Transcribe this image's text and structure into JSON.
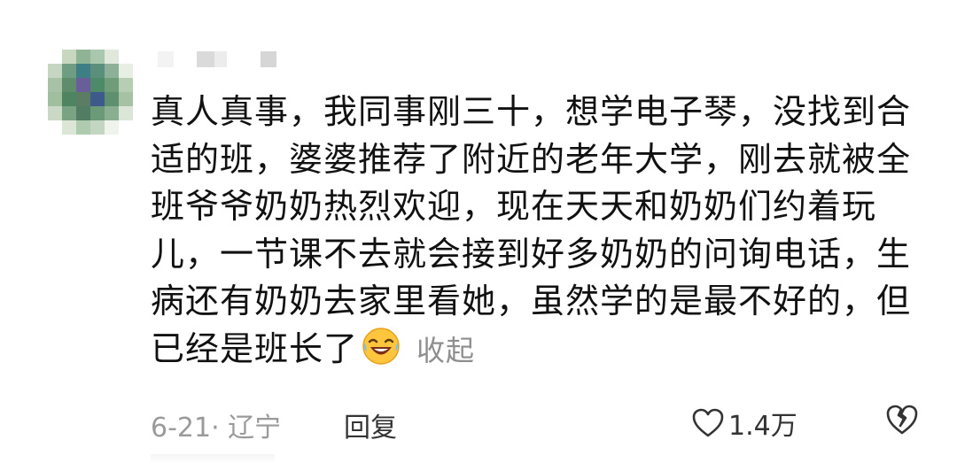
{
  "comment": {
    "text": "真人真事，我同事刚三十，想学电子琴，没找到合适的班，婆婆推荐了附近的老年大学，刚去就被全班爷爷奶奶热烈欢迎，现在天天和奶奶们约着玩儿，一节课不去就会接到好多奶奶的问询电话，生病还有奶奶去家里看她，虽然学的是最不好的，但已经是班长了",
    "emoji": "laughing-crying-emoji",
    "collapse_label": "收起",
    "date_location": "6-21· 辽宁",
    "reply_label": "回复",
    "like_count": "1.4万"
  },
  "colors": {
    "text": "#111111",
    "meta": "#9a9a9a",
    "emoji_face": "#ffc53d"
  }
}
